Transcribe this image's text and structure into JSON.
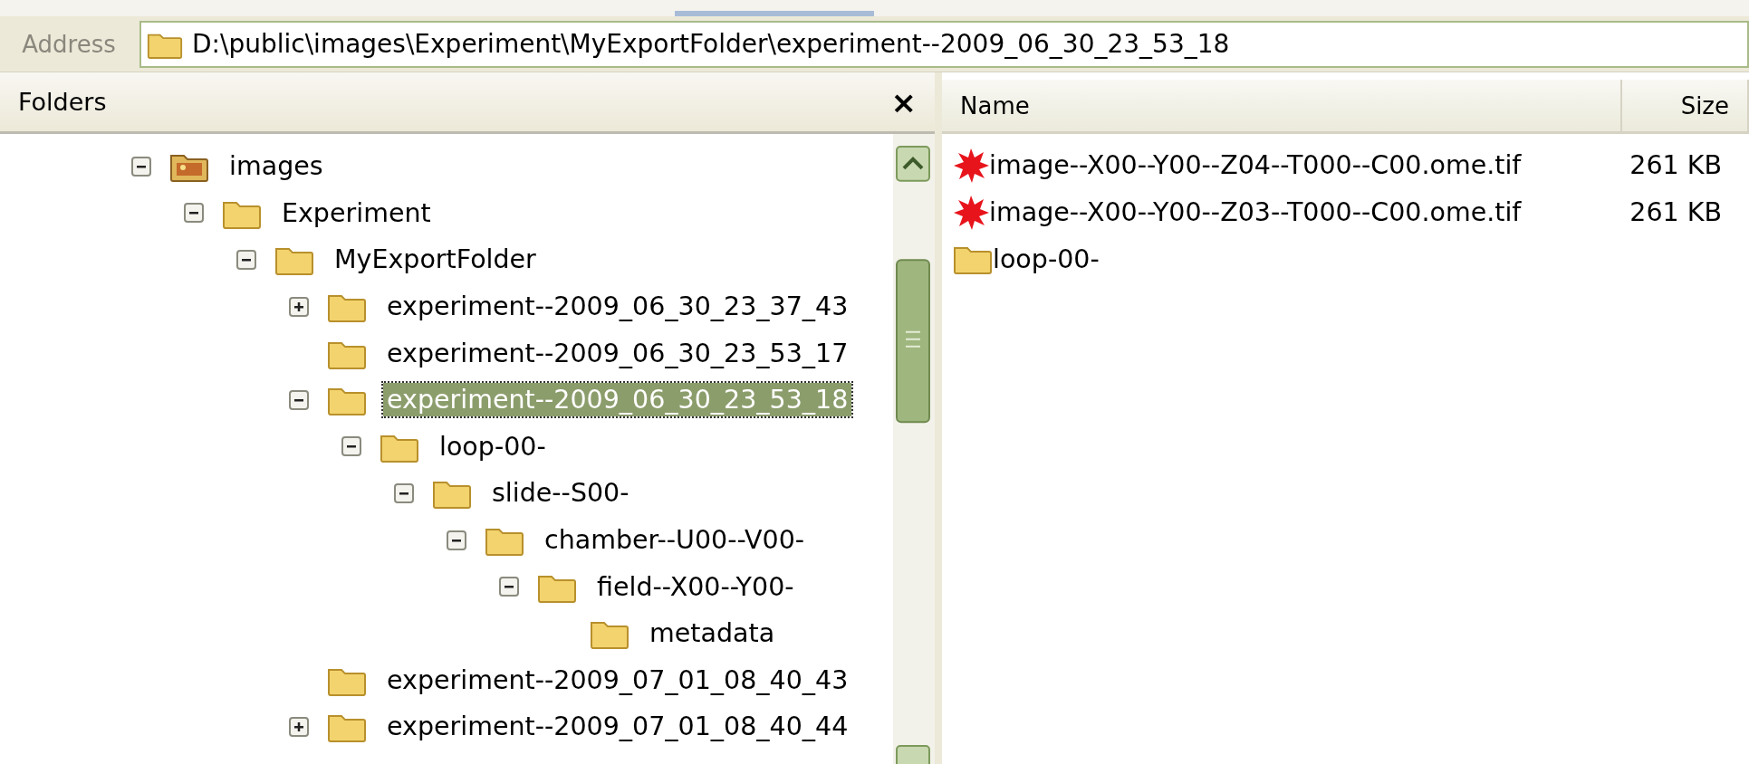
{
  "address_bar": {
    "label": "Address",
    "path": "D:\\public\\images\\Experiment\\MyExportFolder\\experiment--2009_06_30_23_53_18"
  },
  "folders_pane": {
    "title": "Folders",
    "close": "×",
    "tree": [
      {
        "label": "images",
        "kind": "pictures",
        "expanded": true,
        "selected": false,
        "children": [
          {
            "label": "Experiment",
            "kind": "folder",
            "expanded": true,
            "selected": false,
            "children": [
              {
                "label": "MyExportFolder",
                "kind": "folder",
                "expanded": true,
                "selected": false,
                "children": [
                  {
                    "label": "experiment--2009_06_30_23_37_43",
                    "kind": "folder",
                    "expanded": false,
                    "selected": false
                  },
                  {
                    "label": "experiment--2009_06_30_23_53_17",
                    "kind": "folder",
                    "selected": false
                  },
                  {
                    "label": "experiment--2009_06_30_23_53_18",
                    "kind": "folder",
                    "expanded": true,
                    "selected": true,
                    "children": [
                      {
                        "label": "loop-00-",
                        "kind": "folder",
                        "expanded": true,
                        "selected": false,
                        "children": [
                          {
                            "label": "slide--S00-",
                            "kind": "folder",
                            "expanded": true,
                            "selected": false,
                            "children": [
                              {
                                "label": "chamber--U00--V00-",
                                "kind": "folder",
                                "expanded": true,
                                "selected": false,
                                "children": [
                                  {
                                    "label": "field--X00--Y00-",
                                    "kind": "folder",
                                    "expanded": true,
                                    "selected": false,
                                    "children": [
                                      {
                                        "label": "metadata",
                                        "kind": "folder",
                                        "selected": false
                                      }
                                    ]
                                  }
                                ]
                              }
                            ]
                          }
                        ]
                      }
                    ]
                  },
                  {
                    "label": "experiment--2009_07_01_08_40_43",
                    "kind": "folder",
                    "selected": false
                  },
                  {
                    "label": "experiment--2009_07_01_08_40_44",
                    "kind": "folder",
                    "expanded": false,
                    "selected": false
                  }
                ]
              }
            ]
          }
        ]
      }
    ]
  },
  "file_list": {
    "columns": [
      "Name",
      "Size"
    ],
    "rows": [
      {
        "name": "image--X00--Y00--Z04--T000--C00.ome.tif",
        "size": "261 KB",
        "kind": "image"
      },
      {
        "name": "image--X00--Y00--Z03--T000--C00.ome.tif",
        "size": "261 KB",
        "kind": "image"
      },
      {
        "name": "loop-00-",
        "kind": "folder"
      }
    ]
  }
}
